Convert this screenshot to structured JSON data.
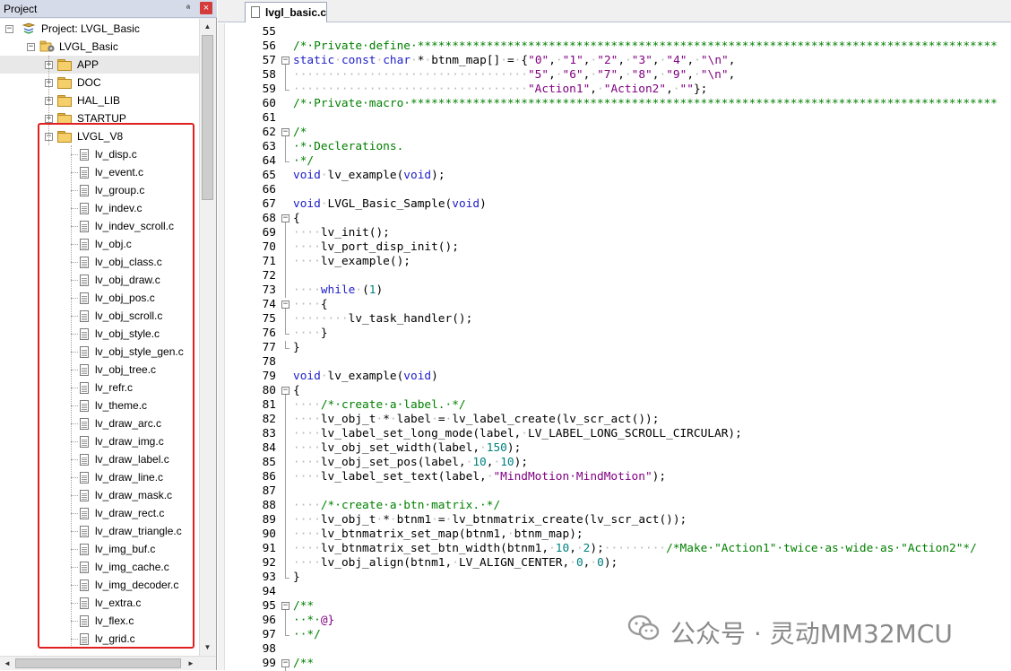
{
  "project_panel": {
    "title": "Project",
    "pin_glyph": "ª",
    "close_glyph": "×",
    "tree": [
      {
        "label": "Project: LVGL_Basic",
        "kind": "project",
        "expander": "−",
        "expanded": true
      },
      {
        "label": "LVGL_Basic",
        "kind": "target",
        "expander": "−",
        "expanded": true
      },
      {
        "label": "APP",
        "kind": "folder",
        "expander": "+",
        "expanded": false
      },
      {
        "label": "DOC",
        "kind": "folder",
        "expander": "+",
        "expanded": false
      },
      {
        "label": "HAL_LIB",
        "kind": "folder",
        "expander": "+",
        "expanded": false
      },
      {
        "label": "STARTUP",
        "kind": "folder",
        "expander": "+",
        "expanded": false
      },
      {
        "label": "LVGL_V8",
        "kind": "folder",
        "expander": "−",
        "expanded": true
      },
      {
        "label": "lv_disp.c",
        "kind": "file"
      },
      {
        "label": "lv_event.c",
        "kind": "file"
      },
      {
        "label": "lv_group.c",
        "kind": "file"
      },
      {
        "label": "lv_indev.c",
        "kind": "file"
      },
      {
        "label": "lv_indev_scroll.c",
        "kind": "file"
      },
      {
        "label": "lv_obj.c",
        "kind": "file"
      },
      {
        "label": "lv_obj_class.c",
        "kind": "file"
      },
      {
        "label": "lv_obj_draw.c",
        "kind": "file"
      },
      {
        "label": "lv_obj_pos.c",
        "kind": "file"
      },
      {
        "label": "lv_obj_scroll.c",
        "kind": "file"
      },
      {
        "label": "lv_obj_style.c",
        "kind": "file"
      },
      {
        "label": "lv_obj_style_gen.c",
        "kind": "file"
      },
      {
        "label": "lv_obj_tree.c",
        "kind": "file"
      },
      {
        "label": "lv_refr.c",
        "kind": "file"
      },
      {
        "label": "lv_theme.c",
        "kind": "file"
      },
      {
        "label": "lv_draw_arc.c",
        "kind": "file"
      },
      {
        "label": "lv_draw_img.c",
        "kind": "file"
      },
      {
        "label": "lv_draw_label.c",
        "kind": "file"
      },
      {
        "label": "lv_draw_line.c",
        "kind": "file"
      },
      {
        "label": "lv_draw_mask.c",
        "kind": "file"
      },
      {
        "label": "lv_draw_rect.c",
        "kind": "file"
      },
      {
        "label": "lv_draw_triangle.c",
        "kind": "file"
      },
      {
        "label": "lv_img_buf.c",
        "kind": "file"
      },
      {
        "label": "lv_img_cache.c",
        "kind": "file"
      },
      {
        "label": "lv_img_decoder.c",
        "kind": "file"
      },
      {
        "label": "lv_extra.c",
        "kind": "file"
      },
      {
        "label": "lv_flex.c",
        "kind": "file"
      },
      {
        "label": "lv_grid.c",
        "kind": "file"
      }
    ],
    "highlight_color": "#e02020",
    "scroll_up_glyph": "▲",
    "scroll_down_glyph": "▼",
    "scroll_left_glyph": "◄",
    "scroll_right_glyph": "►"
  },
  "editor": {
    "tab_label": "lvgl_basic.c",
    "lines": [
      {
        "n": "55",
        "fold": "",
        "segs": []
      },
      {
        "n": "56",
        "fold": "",
        "segs": [
          [
            "cm",
            "/*·Private·define·************************************************************************************"
          ]
        ]
      },
      {
        "n": "57",
        "fold": "box",
        "segs": [
          [
            "kw",
            "static"
          ],
          [
            "dt",
            "·"
          ],
          [
            "kw",
            "const"
          ],
          [
            "dt",
            "·"
          ],
          [
            "kw",
            "char"
          ],
          [
            "dt",
            "·"
          ],
          [
            "",
            "*"
          ],
          [
            "dt",
            "·"
          ],
          [
            "",
            "btnm_map[]"
          ],
          [
            "dt",
            "·"
          ],
          [
            "",
            "="
          ],
          [
            "dt",
            "·"
          ],
          [
            "",
            "{"
          ],
          [
            "st",
            "\"0\""
          ],
          [
            "",
            ","
          ],
          [
            "dt",
            "·"
          ],
          [
            "st",
            "\"1\""
          ],
          [
            "",
            ","
          ],
          [
            "dt",
            "·"
          ],
          [
            "st",
            "\"2\""
          ],
          [
            "",
            ","
          ],
          [
            "dt",
            "·"
          ],
          [
            "st",
            "\"3\""
          ],
          [
            "",
            ","
          ],
          [
            "dt",
            "·"
          ],
          [
            "st",
            "\"4\""
          ],
          [
            "",
            ","
          ],
          [
            "dt",
            "·"
          ],
          [
            "st",
            "\"\\n\""
          ],
          [
            "",
            ","
          ]
        ]
      },
      {
        "n": "58",
        "fold": "line",
        "segs": [
          [
            "dt",
            "··································"
          ],
          [
            "st",
            "\"5\""
          ],
          [
            "",
            ","
          ],
          [
            "dt",
            "·"
          ],
          [
            "st",
            "\"6\""
          ],
          [
            "",
            ","
          ],
          [
            "dt",
            "·"
          ],
          [
            "st",
            "\"7\""
          ],
          [
            "",
            ","
          ],
          [
            "dt",
            "·"
          ],
          [
            "st",
            "\"8\""
          ],
          [
            "",
            ","
          ],
          [
            "dt",
            "·"
          ],
          [
            "st",
            "\"9\""
          ],
          [
            "",
            ","
          ],
          [
            "dt",
            "·"
          ],
          [
            "st",
            "\"\\n\""
          ],
          [
            "",
            ","
          ]
        ]
      },
      {
        "n": "59",
        "fold": "end",
        "segs": [
          [
            "dt",
            "··································"
          ],
          [
            "st",
            "\"Action1\""
          ],
          [
            "",
            ","
          ],
          [
            "dt",
            "·"
          ],
          [
            "st",
            "\"Action2\""
          ],
          [
            "",
            ","
          ],
          [
            "dt",
            "·"
          ],
          [
            "st",
            "\"\""
          ],
          [
            "",
            "};"
          ]
        ]
      },
      {
        "n": "60",
        "fold": "",
        "segs": [
          [
            "cm",
            "/*·Private·macro·*************************************************************************************"
          ]
        ]
      },
      {
        "n": "61",
        "fold": "",
        "segs": []
      },
      {
        "n": "62",
        "fold": "box",
        "segs": [
          [
            "cm",
            "/*"
          ]
        ]
      },
      {
        "n": "63",
        "fold": "line",
        "segs": [
          [
            "cm",
            "·*·Declerations."
          ]
        ]
      },
      {
        "n": "64",
        "fold": "end",
        "segs": [
          [
            "cm",
            "·*/"
          ]
        ]
      },
      {
        "n": "65",
        "fold": "",
        "segs": [
          [
            "kw",
            "void"
          ],
          [
            "dt",
            "·"
          ],
          [
            "",
            "lv_example("
          ],
          [
            "kw",
            "void"
          ],
          [
            "",
            ");"
          ]
        ]
      },
      {
        "n": "66",
        "fold": "",
        "segs": []
      },
      {
        "n": "67",
        "fold": "",
        "segs": [
          [
            "kw",
            "void"
          ],
          [
            "dt",
            "·"
          ],
          [
            "",
            "LVGL_Basic_Sample("
          ],
          [
            "kw",
            "void"
          ],
          [
            "",
            ")"
          ]
        ]
      },
      {
        "n": "68",
        "fold": "box",
        "segs": [
          [
            "",
            "{"
          ]
        ]
      },
      {
        "n": "69",
        "fold": "line",
        "segs": [
          [
            "dt",
            "····"
          ],
          [
            "",
            "lv_init();"
          ]
        ]
      },
      {
        "n": "70",
        "fold": "line",
        "segs": [
          [
            "dt",
            "····"
          ],
          [
            "",
            "lv_port_disp_init();"
          ]
        ]
      },
      {
        "n": "71",
        "fold": "line",
        "segs": [
          [
            "dt",
            "····"
          ],
          [
            "",
            "lv_example();"
          ]
        ]
      },
      {
        "n": "72",
        "fold": "line",
        "segs": []
      },
      {
        "n": "73",
        "fold": "line",
        "segs": [
          [
            "dt",
            "····"
          ],
          [
            "kw",
            "while"
          ],
          [
            "dt",
            "·"
          ],
          [
            "",
            "("
          ],
          [
            "nm",
            "1"
          ],
          [
            "",
            ")"
          ]
        ]
      },
      {
        "n": "74",
        "fold": "box",
        "segs": [
          [
            "dt",
            "····"
          ],
          [
            "",
            "{"
          ]
        ]
      },
      {
        "n": "75",
        "fold": "line",
        "segs": [
          [
            "dt",
            "········"
          ],
          [
            "",
            "lv_task_handler();"
          ]
        ]
      },
      {
        "n": "76",
        "fold": "end",
        "segs": [
          [
            "dt",
            "····"
          ],
          [
            "",
            "}"
          ]
        ]
      },
      {
        "n": "77",
        "fold": "end",
        "segs": [
          [
            "",
            "}"
          ]
        ]
      },
      {
        "n": "78",
        "fold": "",
        "segs": []
      },
      {
        "n": "79",
        "fold": "",
        "segs": [
          [
            "kw",
            "void"
          ],
          [
            "dt",
            "·"
          ],
          [
            "",
            "lv_example("
          ],
          [
            "kw",
            "void"
          ],
          [
            "",
            ")"
          ]
        ]
      },
      {
        "n": "80",
        "fold": "box",
        "segs": [
          [
            "",
            "{"
          ]
        ]
      },
      {
        "n": "81",
        "fold": "line",
        "segs": [
          [
            "dt",
            "····"
          ],
          [
            "cm",
            "/*·create·a·label.·*/"
          ]
        ]
      },
      {
        "n": "82",
        "fold": "line",
        "segs": [
          [
            "dt",
            "····"
          ],
          [
            "",
            "lv_obj_t"
          ],
          [
            "dt",
            "·"
          ],
          [
            "",
            "*"
          ],
          [
            "dt",
            "·"
          ],
          [
            "",
            "label"
          ],
          [
            "dt",
            "·"
          ],
          [
            "",
            "="
          ],
          [
            "dt",
            "·"
          ],
          [
            "",
            "lv_label_create(lv_scr_act());"
          ]
        ]
      },
      {
        "n": "83",
        "fold": "line",
        "segs": [
          [
            "dt",
            "····"
          ],
          [
            "",
            "lv_label_set_long_mode(label,"
          ],
          [
            "dt",
            "·"
          ],
          [
            "",
            "LV_LABEL_LONG_SCROLL_CIRCULAR);"
          ]
        ]
      },
      {
        "n": "84",
        "fold": "line",
        "segs": [
          [
            "dt",
            "····"
          ],
          [
            "",
            "lv_obj_set_width(label,"
          ],
          [
            "dt",
            "·"
          ],
          [
            "nm",
            "150"
          ],
          [
            "",
            ");"
          ]
        ]
      },
      {
        "n": "85",
        "fold": "line",
        "segs": [
          [
            "dt",
            "····"
          ],
          [
            "",
            "lv_obj_set_pos(label,"
          ],
          [
            "dt",
            "·"
          ],
          [
            "nm",
            "10"
          ],
          [
            "",
            ","
          ],
          [
            "dt",
            "·"
          ],
          [
            "nm",
            "10"
          ],
          [
            "",
            ");"
          ]
        ]
      },
      {
        "n": "86",
        "fold": "line",
        "segs": [
          [
            "dt",
            "····"
          ],
          [
            "",
            "lv_label_set_text(label,"
          ],
          [
            "dt",
            "·"
          ],
          [
            "st",
            "\"MindMotion·MindMotion\""
          ],
          [
            "",
            ");"
          ]
        ]
      },
      {
        "n": "87",
        "fold": "line",
        "segs": []
      },
      {
        "n": "88",
        "fold": "line",
        "segs": [
          [
            "dt",
            "····"
          ],
          [
            "cm",
            "/*·create·a·btn·matrix.·*/"
          ]
        ]
      },
      {
        "n": "89",
        "fold": "line",
        "segs": [
          [
            "dt",
            "····"
          ],
          [
            "",
            "lv_obj_t"
          ],
          [
            "dt",
            "·"
          ],
          [
            "",
            "*"
          ],
          [
            "dt",
            "·"
          ],
          [
            "",
            "btnm1"
          ],
          [
            "dt",
            "·"
          ],
          [
            "",
            "="
          ],
          [
            "dt",
            "·"
          ],
          [
            "",
            "lv_btnmatrix_create(lv_scr_act());"
          ]
        ]
      },
      {
        "n": "90",
        "fold": "line",
        "segs": [
          [
            "dt",
            "····"
          ],
          [
            "",
            "lv_btnmatrix_set_map(btnm1,"
          ],
          [
            "dt",
            "·"
          ],
          [
            "",
            "btnm_map);"
          ]
        ]
      },
      {
        "n": "91",
        "fold": "line",
        "segs": [
          [
            "dt",
            "····"
          ],
          [
            "",
            "lv_btnmatrix_set_btn_width(btnm1,"
          ],
          [
            "dt",
            "·"
          ],
          [
            "nm",
            "10"
          ],
          [
            "",
            ","
          ],
          [
            "dt",
            "·"
          ],
          [
            "nm",
            "2"
          ],
          [
            "",
            ");"
          ],
          [
            "dt",
            "·········"
          ],
          [
            "cm",
            "/*Make·\"Action1\"·twice·as·wide·as·\"Action2\"*/"
          ]
        ]
      },
      {
        "n": "92",
        "fold": "line",
        "segs": [
          [
            "dt",
            "····"
          ],
          [
            "",
            "lv_obj_align(btnm1,"
          ],
          [
            "dt",
            "·"
          ],
          [
            "",
            "LV_ALIGN_CENTER,"
          ],
          [
            "dt",
            "·"
          ],
          [
            "nm",
            "0"
          ],
          [
            "",
            ","
          ],
          [
            "dt",
            "·"
          ],
          [
            "nm",
            "0"
          ],
          [
            "",
            ");"
          ]
        ]
      },
      {
        "n": "93",
        "fold": "end",
        "segs": [
          [
            "",
            "}"
          ]
        ]
      },
      {
        "n": "94",
        "fold": "",
        "segs": []
      },
      {
        "n": "95",
        "fold": "box",
        "segs": [
          [
            "cm",
            "/**"
          ]
        ]
      },
      {
        "n": "96",
        "fold": "line",
        "segs": [
          [
            "cm",
            "··*·"
          ],
          [
            "st",
            "@}"
          ]
        ]
      },
      {
        "n": "97",
        "fold": "end",
        "segs": [
          [
            "cm",
            "··*/"
          ]
        ]
      },
      {
        "n": "98",
        "fold": "",
        "segs": []
      },
      {
        "n": "99",
        "fold": "box",
        "segs": [
          [
            "cm",
            "/**"
          ]
        ]
      }
    ]
  },
  "watermark": {
    "text": "公众号 · 灵动MM32MCU",
    "icon": "wechat-icon",
    "color": "#8a8a8a"
  }
}
